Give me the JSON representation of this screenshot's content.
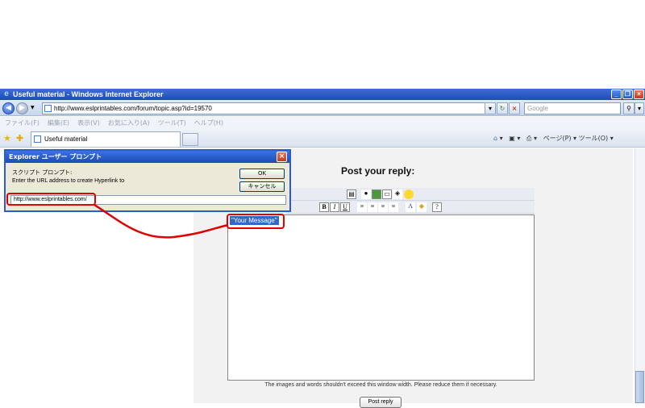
{
  "window": {
    "title": "Useful material - Windows Internet Explorer",
    "minimize": "_",
    "maximize": "❐",
    "close": "×"
  },
  "address_bar": {
    "url": "http://www.eslprintables.com/forum/topic.asp?id=19570",
    "search_placeholder": "Google",
    "back": "◀",
    "forward": "▶"
  },
  "menu": [
    "ファイル(F)",
    "編集(E)",
    "表示(V)",
    "お気に入り(A)",
    "ツール(T)",
    "ヘルプ(H)"
  ],
  "tabs": {
    "active_label": "Useful material"
  },
  "toolbar_right": "ページ(P) ▾  ツール(O) ▾",
  "page": {
    "heading": "Post your reply:",
    "editor_text": "\"Your Message\"",
    "notice": "The images and words shouldn't exceed this window width. Please reduce them if necessary.",
    "post_button": "Post reply"
  },
  "dialog": {
    "title": "Explorer ユーザー プロンプト",
    "label_script": "スクリプト プロンプト:",
    "label_prompt": "Enter the URL address to create Hyperlink to",
    "ok": "OK",
    "cancel": "キャンセル",
    "input_value": "http://www.eslprintables.com/",
    "close": "×"
  },
  "colors": {
    "title_blue": "#1c4bb8",
    "highlight_red": "#e00000",
    "selection_blue": "#316ac5"
  }
}
